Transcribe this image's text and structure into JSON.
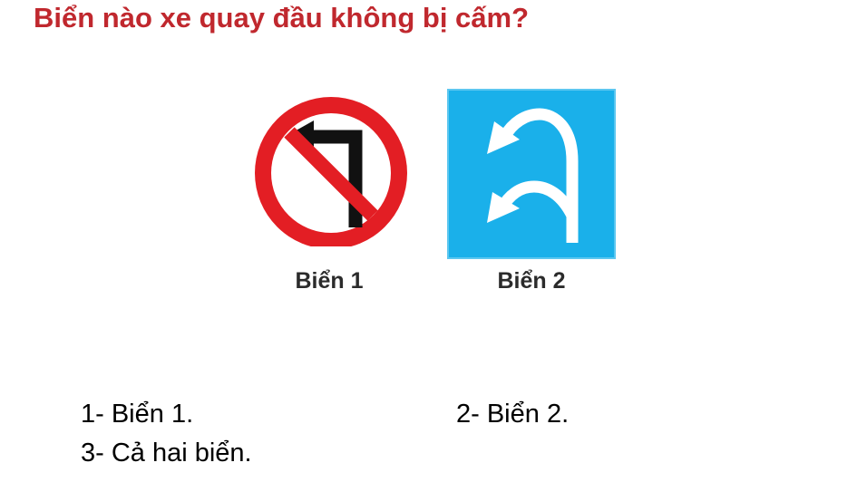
{
  "question": "Biển nào xe quay đầu không bị cấm?",
  "signs": [
    {
      "caption": "Biển 1",
      "icon": "no-left-turn-sign",
      "colors": {
        "ring": "#e31e24",
        "bar": "#e31e24",
        "arrow": "#111111",
        "fill": "#ffffff"
      }
    },
    {
      "caption": "Biển 2",
      "icon": "u-turn-lane-sign",
      "colors": {
        "background": "#1ab0ea",
        "border": "#1ab0ea",
        "arrow": "#ffffff"
      }
    }
  ],
  "answers": [
    {
      "label": "1- Biển 1."
    },
    {
      "label": "2- Biển 2."
    },
    {
      "label": "3- Cả hai biển."
    }
  ],
  "colors": {
    "question": "#c0282e",
    "text": "#000000"
  }
}
